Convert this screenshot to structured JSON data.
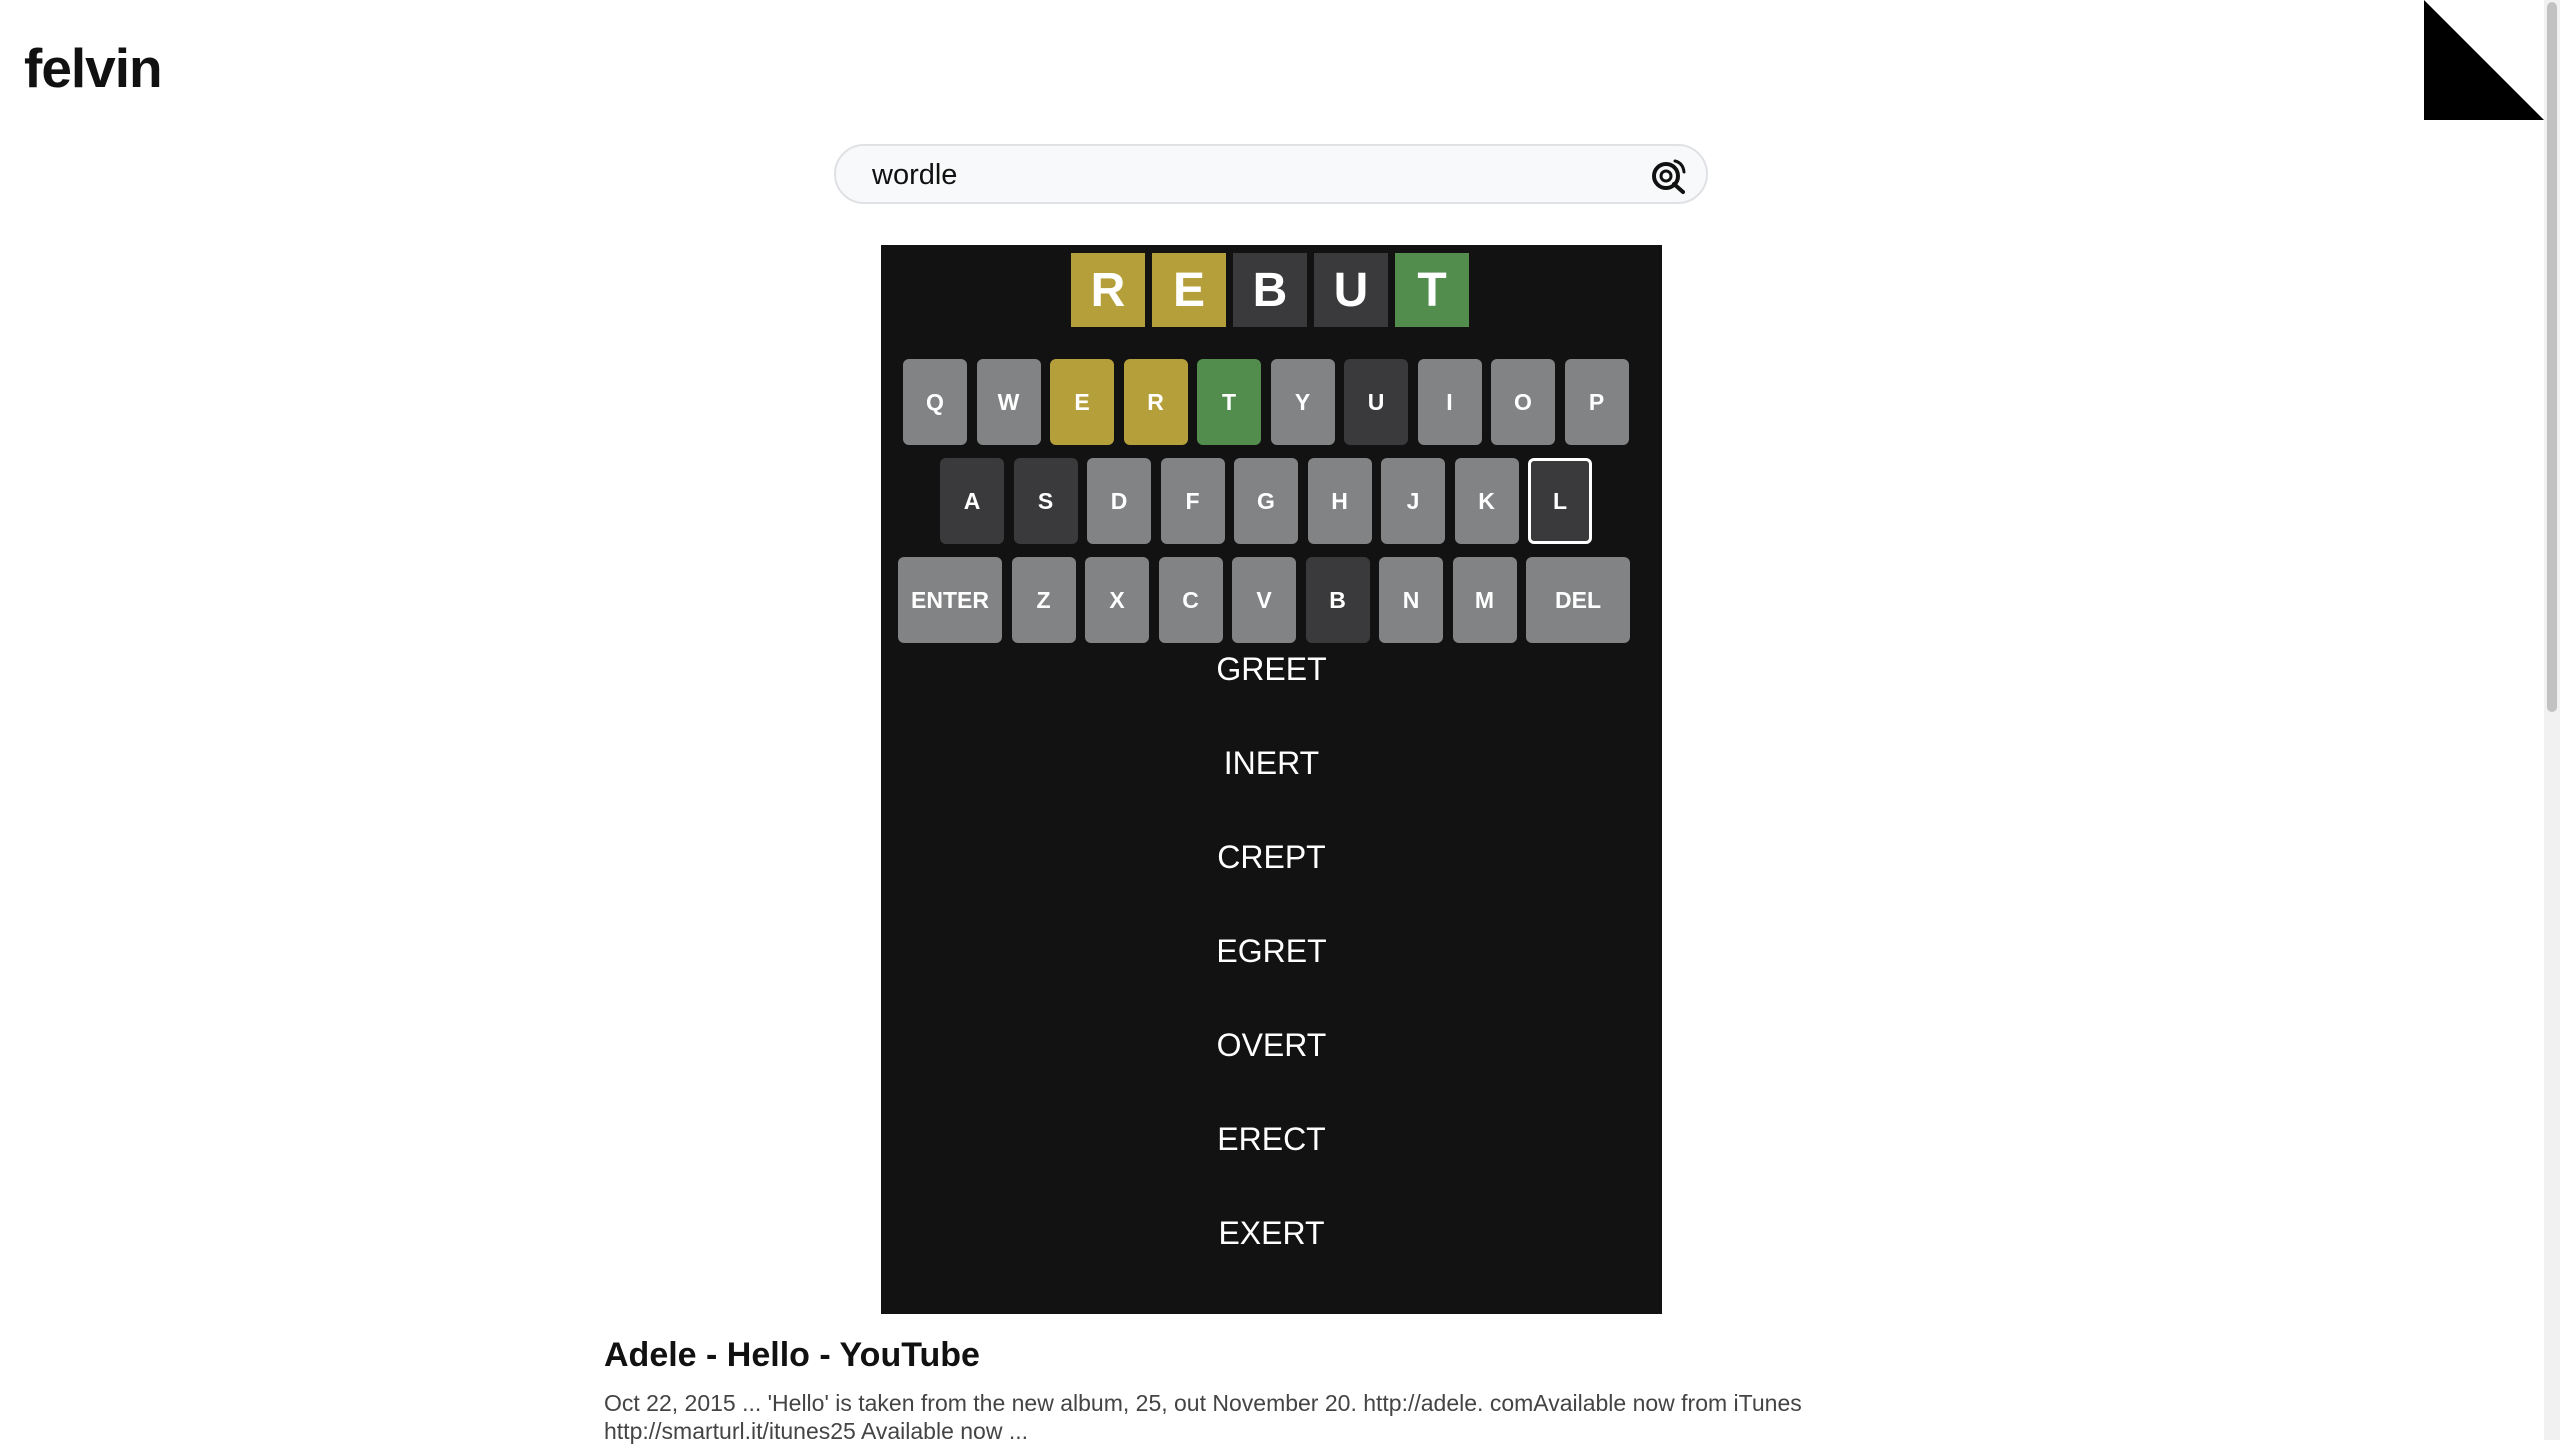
{
  "header": {
    "logo": "felvin"
  },
  "search": {
    "value": "wordle",
    "placeholder": ""
  },
  "wordle": {
    "guess": [
      {
        "letter": "R",
        "state": "present"
      },
      {
        "letter": "E",
        "state": "present"
      },
      {
        "letter": "B",
        "state": "absent"
      },
      {
        "letter": "U",
        "state": "absent"
      },
      {
        "letter": "T",
        "state": "correct"
      }
    ],
    "keyboard": [
      [
        {
          "label": "Q",
          "state": "unused"
        },
        {
          "label": "W",
          "state": "unused"
        },
        {
          "label": "E",
          "state": "present"
        },
        {
          "label": "R",
          "state": "present"
        },
        {
          "label": "T",
          "state": "correct"
        },
        {
          "label": "Y",
          "state": "unused"
        },
        {
          "label": "U",
          "state": "absent"
        },
        {
          "label": "I",
          "state": "unused"
        },
        {
          "label": "O",
          "state": "unused"
        },
        {
          "label": "P",
          "state": "unused"
        }
      ],
      [
        {
          "label": "A",
          "state": "absent"
        },
        {
          "label": "S",
          "state": "absent"
        },
        {
          "label": "D",
          "state": "unused"
        },
        {
          "label": "F",
          "state": "unused"
        },
        {
          "label": "G",
          "state": "unused"
        },
        {
          "label": "H",
          "state": "unused"
        },
        {
          "label": "J",
          "state": "unused"
        },
        {
          "label": "K",
          "state": "unused"
        },
        {
          "label": "L",
          "state": "absent",
          "selected": true
        }
      ],
      [
        {
          "label": "ENTER",
          "state": "unused",
          "wide": true
        },
        {
          "label": "Z",
          "state": "unused"
        },
        {
          "label": "X",
          "state": "unused"
        },
        {
          "label": "C",
          "state": "unused"
        },
        {
          "label": "V",
          "state": "unused"
        },
        {
          "label": "B",
          "state": "absent"
        },
        {
          "label": "N",
          "state": "unused"
        },
        {
          "label": "M",
          "state": "unused"
        },
        {
          "label": "DEL",
          "state": "unused",
          "wide": true
        }
      ]
    ],
    "suggestions": [
      "GREET",
      "INERT",
      "CREPT",
      "EGRET",
      "OVERT",
      "ERECT",
      "EXERT"
    ]
  },
  "result": {
    "title": "Adele - Hello - YouTube",
    "snippet": "Oct 22, 2015 ... 'Hello' is taken from the new album, 25, out November 20. http://adele. comAvailable now from iTunes http://smarturl.it/itunes25 Available now ..."
  },
  "colors": {
    "correct": "#538d4e",
    "present": "#b59f3b",
    "absent": "#3a3a3c",
    "unused": "#818384",
    "panel": "#121212"
  },
  "icons": {
    "search": "search-icon",
    "github": "github-icon"
  }
}
